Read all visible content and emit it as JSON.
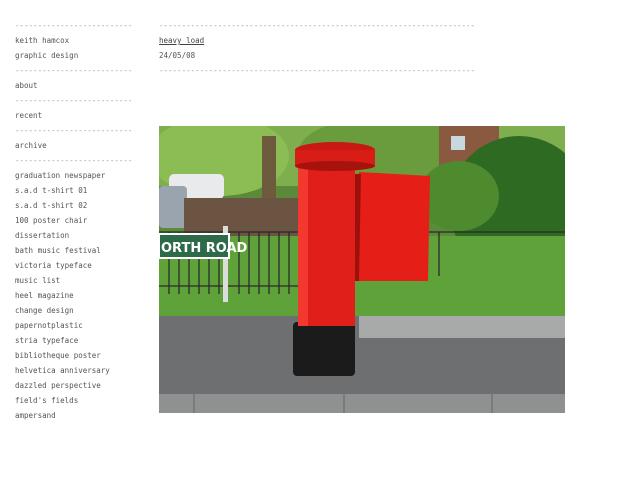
{
  "sidebar": {
    "author": "keith hamcox",
    "subtitle": "graphic design",
    "nav": [
      {
        "label": "about"
      },
      {
        "label": "recent"
      },
      {
        "label": "archive"
      }
    ],
    "projects": [
      "graduation newspaper",
      "s.a.d t-shirt 01",
      "s.a.d t-shirt 02",
      "100 poster chair",
      "dissertation",
      "bath music festival",
      "victoria typeface",
      "music list",
      "heel magazine",
      "change design",
      "papernotplastic",
      "stria typeface",
      "bibliotheque poster",
      "helvetica anniversary",
      "dazzled perspective",
      "field's fields",
      "ampersand"
    ]
  },
  "post": {
    "title": "heavy load",
    "date": "24/05/08",
    "image_sign_text": "ORTH ROAD"
  },
  "divider": "----------------------------------------------------------------------",
  "colors": {
    "postbox_red": "#e01f1a",
    "sign_green": "#2d6a4a",
    "text": "#555555"
  }
}
